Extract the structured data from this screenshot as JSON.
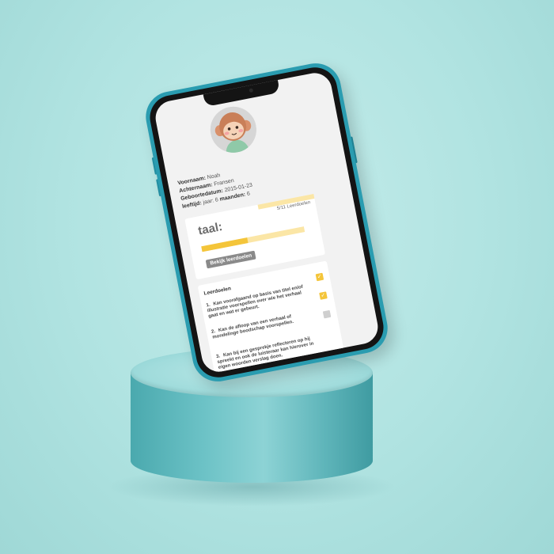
{
  "profile": {
    "first_name_label": "Voornaam:",
    "first_name": "Noah",
    "last_name_label": "Achternaam:",
    "last_name": "Fransen",
    "birthdate_label": "Geboortedatum:",
    "birthdate": "2015-01-23",
    "age_label": "leeftijd:",
    "age_years_label": "jaar:",
    "age_years": "6",
    "age_months_label": "maanden:",
    "age_months": "6"
  },
  "subject": {
    "name": "taal:",
    "goal_count": "5/11 Leerdoelen",
    "progress_fraction": 0.45,
    "show_goals_label": "Bekijk leerdoelen"
  },
  "goals": {
    "title": "Leerdoelen",
    "items": [
      {
        "num": "1.",
        "text": "Kan voorafgaand op basis van titel en/of illustratie voorspellen over wie het verhaal gaat en wat er gebeurt.",
        "checked": true
      },
      {
        "num": "2.",
        "text": "Kan de afloop van een verhaal of mondelinge boodschap voorspellen.",
        "checked": false
      },
      {
        "num": "3.",
        "text": "Kan bij een gesprekje reflecteren op hij spreekt en ook de luisteraar kan hierover in eigen woorden verslag doen.",
        "checked": false
      }
    ]
  },
  "colors": {
    "accent": "#f4c53a",
    "phone_frame": "#2a9cb0",
    "background": "#b0e3e1"
  }
}
